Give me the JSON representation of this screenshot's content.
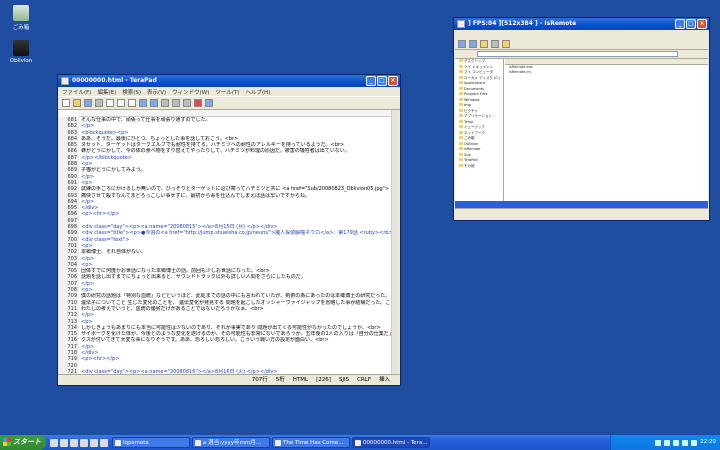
{
  "desktop": {
    "icons": [
      {
        "label": "ごみ箱"
      },
      {
        "label": "Oblivion"
      }
    ]
  },
  "tera": {
    "title": "00000000.html - TeraPad",
    "menu": [
      "ファイル(F)",
      "編集(E)",
      "検索(S)",
      "表示(V)",
      "ウィンドウ(W)",
      "ツール(T)",
      "ヘルプ(H)"
    ],
    "lines": [
      {
        "n": "681",
        "t": "そんな仕事の中で、頑張って仕事を頑張り通すのでした。"
      },
      {
        "n": "682",
        "t": "</p>"
      },
      {
        "n": "683",
        "t": "<blockquote><p>"
      },
      {
        "n": "684",
        "t": "ああ、そうだ。最後にひとつ、ちょっとした事を話しておこう。<br>"
      },
      {
        "n": "685",
        "t": "ヌセット、ターゲットはタークエルフでも耐性を持てる。ハチミツへの耐性のアレルギーを持っているようだ。<br>"
      },
      {
        "n": "686",
        "t": "蜂がどうにかして、今の体の食べ物をすり替えてやったりして、ハチミツが料理の原因だ。被害の犠牲者は出ていない。"
      },
      {
        "n": "687",
        "t": "</p></blockquote>"
      },
      {
        "n": "688",
        "t": "<p>"
      },
      {
        "n": "689",
        "t": "子猫がどうにかしてみよう。"
      },
      {
        "n": "690",
        "t": "</p>"
      },
      {
        "n": "691",
        "t": "<p>"
      },
      {
        "n": "692",
        "t": "試練の手ごろにかけるしか無いので、ひっそりとターゲットに忍び寄ってハチミツと共に <a href=\"Sub/20080823_Oblivion05.jpg\">"
      },
      {
        "n": "693",
        "t": "痛快させて殺すなんてまどろっこしい事せずに、最初から毒を仕込んでしまえば話は早いですからね。"
      },
      {
        "n": "694",
        "t": "</p>"
      },
      {
        "n": "695",
        "t": "</div>"
      },
      {
        "n": "696",
        "t": "<p><hr></p>"
      },
      {
        "n": "697",
        "t": ""
      },
      {
        "n": "698",
        "t": "<div class=\"day\"><p><a name=\"20080815\"></a>8月15日 (月) </p></div>"
      },
      {
        "n": "699",
        "t": "<div class=\"title\"><p>●今週の<a href=\"http://jump.shueisha.co.jp/neuro/\">魔人探偵脳噛ネウロ</a>：第179話 <ruby><rb>蛆</rb><rp>(</rp><rt>うじ</rt><rp>)</rp></ruby>"
      },
      {
        "n": "700",
        "t": "<div class=\"text\">"
      },
      {
        "n": "701",
        "t": "<p>"
      },
      {
        "n": "702",
        "t": "本郷博士、それ自体がない。"
      },
      {
        "n": "703",
        "t": "</p>"
      },
      {
        "n": "704",
        "t": "<p>"
      },
      {
        "n": "705",
        "t": "団体すでに何度かお世話になった本郷博士の話。前回も少しお世話になった。<br>"
      },
      {
        "n": "706",
        "t": "話題を話し出すまでにちょっと出来ると、サウンドトラック以外も詳しい人間をさらにしたものだ。"
      },
      {
        "n": "707",
        "t": "</p>"
      },
      {
        "n": "708",
        "t": "<p>"
      },
      {
        "n": "709",
        "t": "僕の研究の話題は『特別な血統』などというほど、此処までの話の中にも言われていたが、剣術の為にあったのは本郷博士の研究だった。という"
      },
      {
        "n": "710",
        "t": "遺伝子についてこと 生じた変化のことを、 遺伝変化が発見する 問題を起こしたオッシャーヴァイジャップを省略した事が結構だった。ここまでくれば、"
      },
      {
        "n": "711",
        "t": "わたしの考えでいうと、血統の優劣だけがあることではないだろうかなぁ。<br>"
      },
      {
        "n": "712",
        "t": "</p>"
      },
      {
        "n": "713",
        "t": "<p>"
      },
      {
        "n": "714",
        "t": "しかしきょうもあまりにも本当に可能性は少ないのであり、それが事実であり 問題が出てくる可能性がなかったのでしょうか。<br>"
      },
      {
        "n": "715",
        "t": "サイボーグを化けた体が、今後どのような変化を遂げるのか、その可能性も非常にないであろうか。五年後の1人の入りは「自分の仕業だ」と"
      },
      {
        "n": "716",
        "t": "クスが付いてきて大変な事になりそうです。ああ、恐ろしい恐ろしい。こういう戦い方の設定が面白い。<br>"
      },
      {
        "n": "717",
        "t": "</p>"
      },
      {
        "n": "718",
        "t": "</div>"
      },
      {
        "n": "719",
        "t": "<p><hr></p>"
      },
      {
        "n": "720",
        "t": ""
      },
      {
        "n": "721",
        "t": "<div class=\"day\"><p><a name=\"20080816\"></a>8月16日 (火) </p></div>"
      }
    ],
    "status": {
      "pos": "707行",
      "col": "5桁",
      "mode": "HTML",
      "size": "[226]",
      "enc": "SJIS",
      "eol": "CRLF",
      "ins": "挿入"
    }
  },
  "remote": {
    "title": "] FPS:84 ][512x384 ] - IsRemote",
    "tree": [
      "デスクトップ",
      "マイ ドキュメント",
      "マイ コンピュータ",
      "ローカル ディスク (C:)",
      "Applications",
      "Documents",
      "Program Files",
      "Windows",
      "tmp",
      "ピクチャ",
      "アプリケーション",
      "Temp",
      "ミュージック",
      "ネットワーク",
      "ごみ箱",
      "Oblivion",
      "IsRemote",
      "Sub",
      "TeraPad",
      "その他"
    ],
    "files": [
      "IsRemote.exe",
      "IsRemote.ini"
    ],
    "status": "IsRemote"
  },
  "taskbar": {
    "start": "スタート",
    "buttons": [
      {
        "label": "Iqpsmota",
        "active": false
      },
      {
        "label": "a 週当:yyyy年mm月...",
        "active": false
      },
      {
        "label": "The Time Has Come...",
        "active": false
      },
      {
        "label": "00000000.html - Tera...",
        "active": true
      }
    ],
    "clock": "22:20"
  },
  "colors": {
    "desktop": "#1f4ea1",
    "title": "#0a4fd0",
    "tag": "#1f3fbf"
  }
}
